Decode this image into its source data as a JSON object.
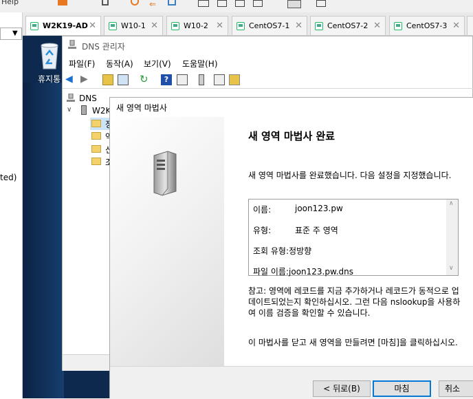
{
  "host": {
    "top_menu_fragment": "Help",
    "left_fragment": "ted)"
  },
  "tabs": [
    {
      "label": "W2K19-AD",
      "active": true
    },
    {
      "label": "W10-1",
      "active": false
    },
    {
      "label": "W10-2",
      "active": false
    },
    {
      "label": "CentOS7-1",
      "active": false
    },
    {
      "label": "CentOS7-2",
      "active": false
    },
    {
      "label": "CentOS7-3",
      "active": false
    }
  ],
  "desktop": {
    "recycle_bin_label": "휴지통"
  },
  "dns_manager": {
    "title": "DNS 관리자",
    "menu": [
      "파일(F)",
      "동작(A)",
      "보기(V)",
      "도움말(H)"
    ],
    "tree": {
      "root": "DNS",
      "server": "W2K",
      "folders": [
        "정",
        "역",
        "신",
        "조"
      ]
    }
  },
  "wizard": {
    "title": "새 영역 마법사",
    "heading": "새 영역 마법사 완료",
    "intro": "새 영역 마법사를 완료했습니다. 다음 설정을 지정했습니다.",
    "summary": [
      {
        "label": "이름:",
        "value": "joon123.pw"
      },
      {
        "label": "유형:",
        "value": "표준 주 영역"
      },
      {
        "label": "조회 유형:",
        "value": "정방향"
      },
      {
        "label": "파일 이름:",
        "value": "joon123.pw.dns"
      }
    ],
    "note_lines": [
      "참고: 영역에 레코드를 지금 추가하거나 레코드가 동적으로 업",
      "데이트되었는지 확인하십시오. 그런 다음 nslookup을 사용하",
      "여 이름 검증을 확인할 수 있습니다."
    ],
    "finish_hint": "이 마법사를 닫고 새 영역을 만들려면 [마침]을 클릭하십시오.",
    "buttons": {
      "back": "< 뒤로(B)",
      "finish": "마침",
      "cancel": "취소"
    }
  }
}
